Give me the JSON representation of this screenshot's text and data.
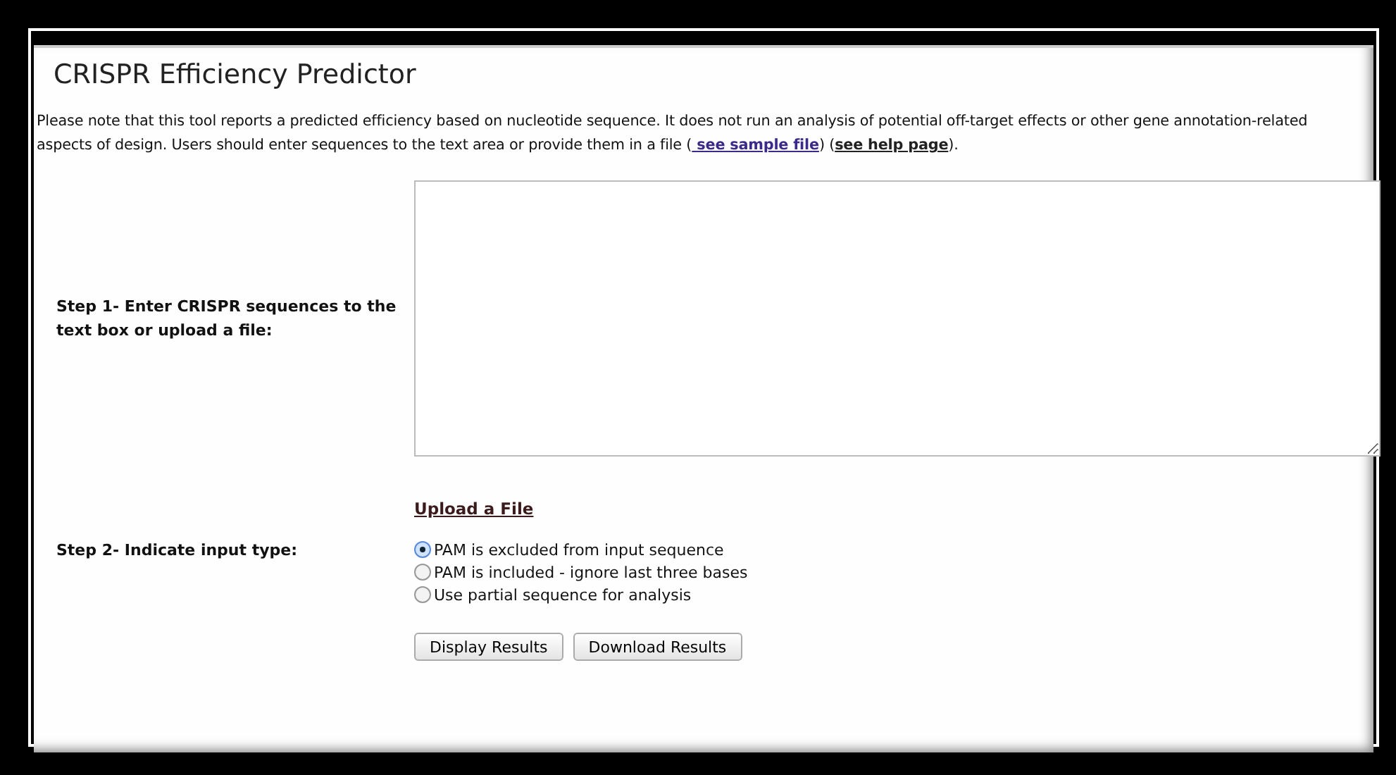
{
  "title": "CRISPR Efficiency Predictor",
  "intro": [
    {
      "kind": "text",
      "text": "Please note that this tool reports a predicted efficiency based on nucleotide sequence. It does not run an analysis of potential off-target effects or other gene annotation-related aspects of design. Users should enter sequences to the text area or provide them in a file ("
    },
    {
      "kind": "link",
      "text": " see sample file",
      "visited": true
    },
    {
      "kind": "text",
      "text": ") ("
    },
    {
      "kind": "link",
      "text": "see help page",
      "visited": false
    },
    {
      "kind": "text",
      "text": ")."
    }
  ],
  "step1": {
    "label": "Step 1- Enter CRISPR sequences to the text box or upload a file:",
    "upload_link": "Upload a File"
  },
  "step2": {
    "label": "Step 2- Indicate input type:",
    "options": [
      {
        "label": "PAM is excluded from input sequence",
        "selected": true
      },
      {
        "label": "PAM is included - ignore last three bases",
        "selected": false
      },
      {
        "label": "Use partial sequence for analysis",
        "selected": false
      }
    ]
  },
  "buttons": [
    "Display Results",
    "Download Results"
  ]
}
